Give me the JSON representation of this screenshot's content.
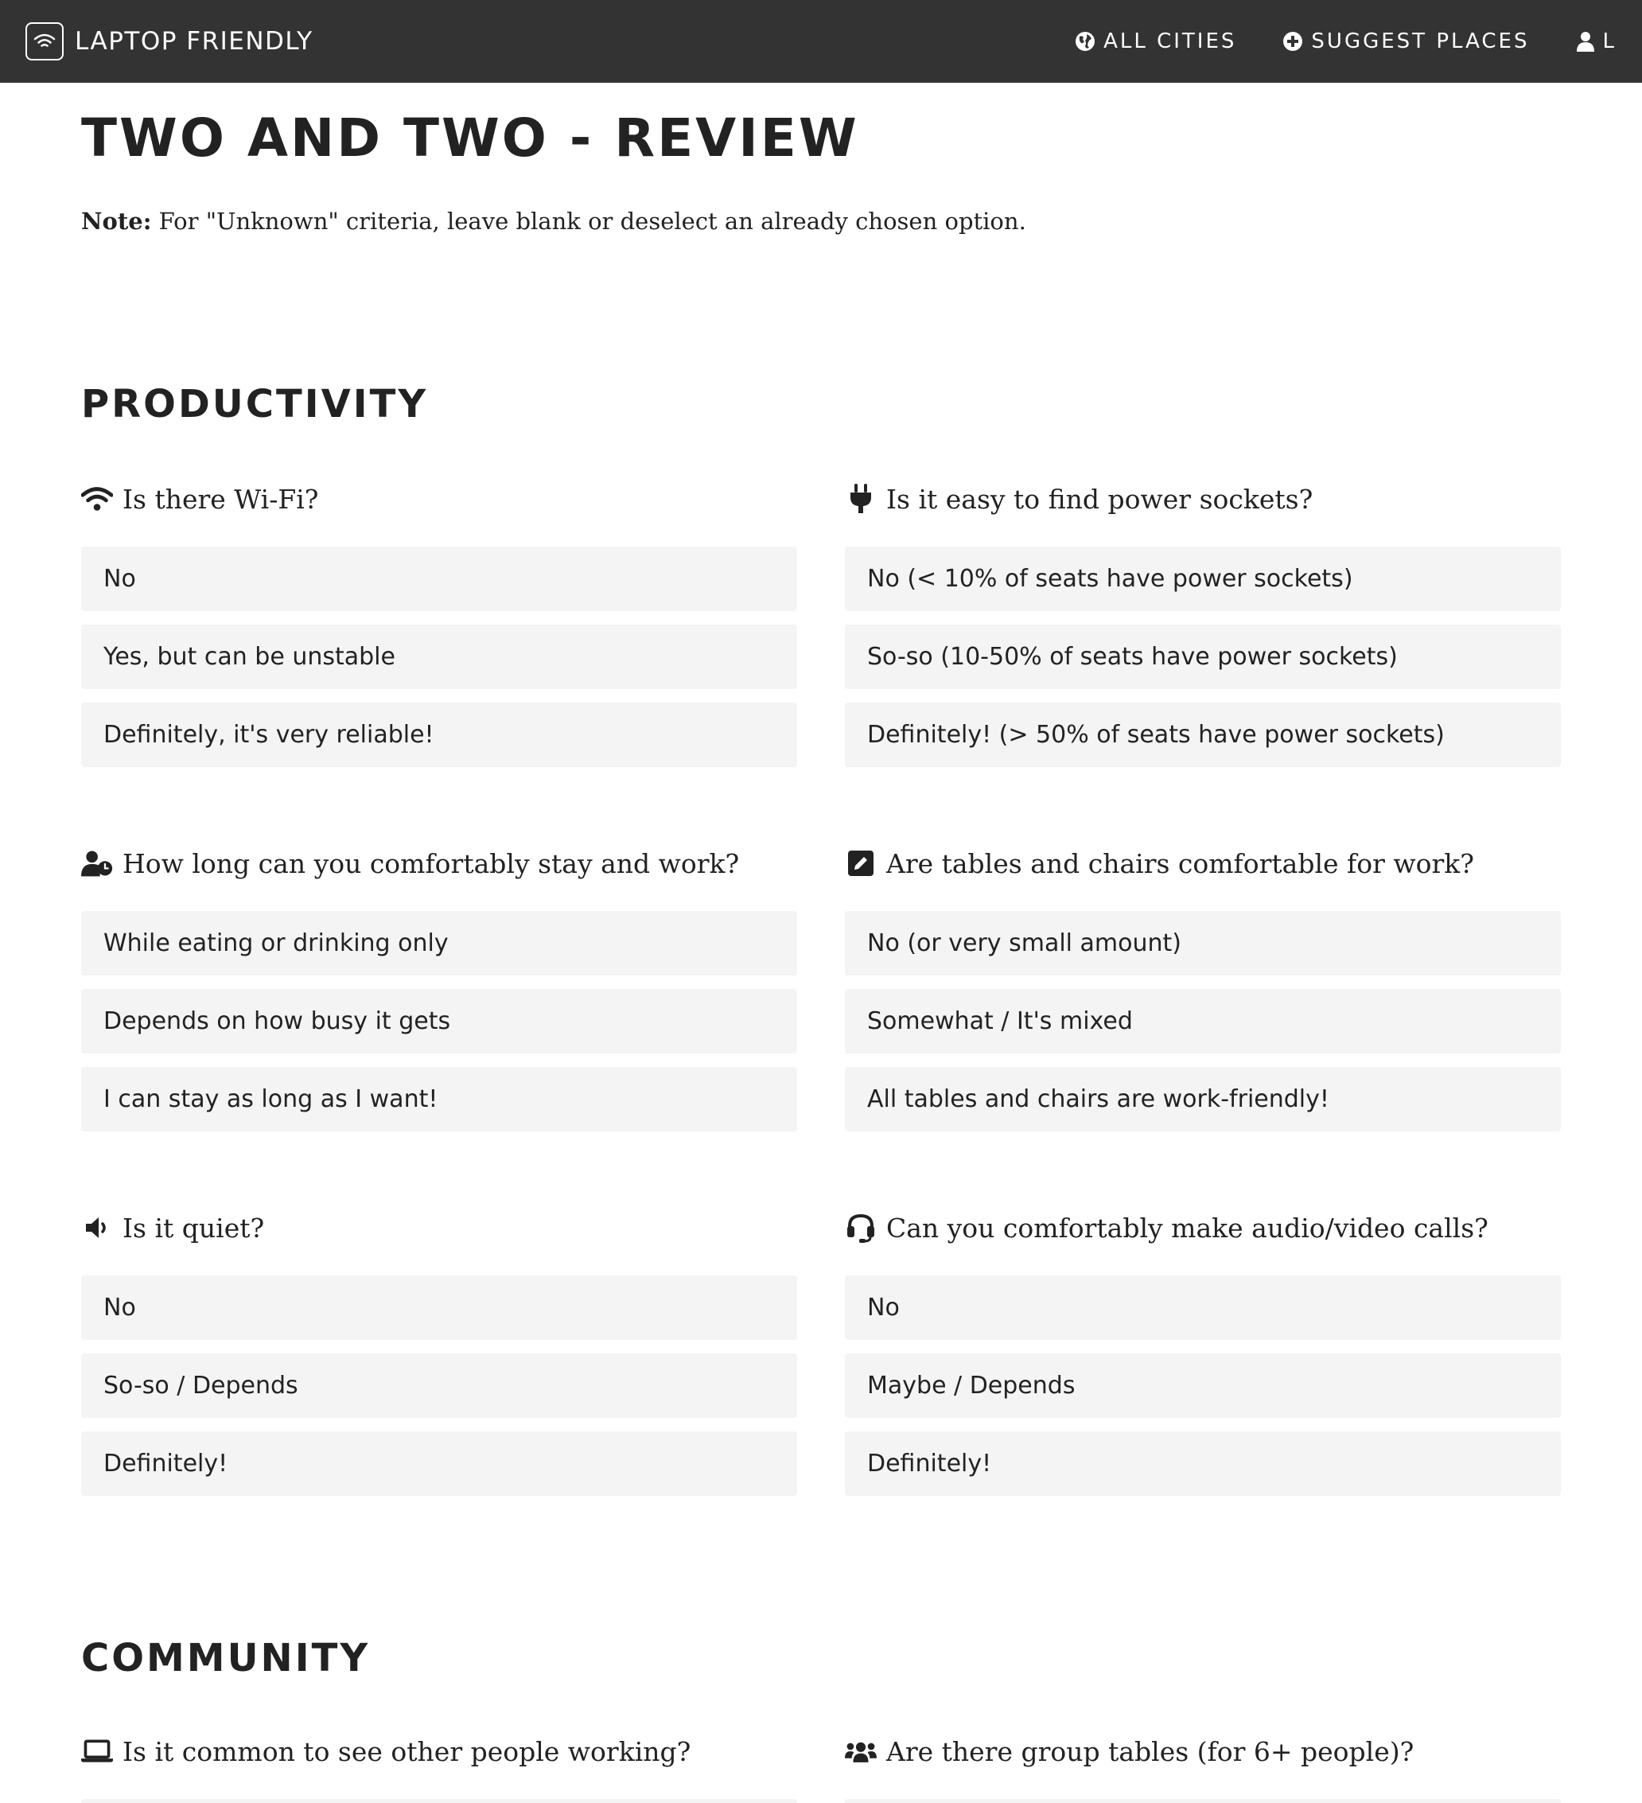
{
  "nav": {
    "brand": "LAPTOP FRIENDLY",
    "all_cities": "ALL CITIES",
    "suggest_places": "SUGGEST PLACES",
    "user": "L"
  },
  "page": {
    "title": "TWO AND TWO - REVIEW",
    "note_label": "Note:",
    "note_text": " For \"Unknown\" criteria, leave blank or deselect an already chosen option."
  },
  "sections": {
    "productivity": "PRODUCTIVITY",
    "community": "COMMUNITY"
  },
  "questions": {
    "wifi": {
      "icon": "wifi-icon",
      "label": "Is there Wi-Fi?",
      "options": [
        "No",
        "Yes, but can be unstable",
        "Definitely, it's very reliable!"
      ]
    },
    "power": {
      "icon": "plug-icon",
      "label": "Is it easy to find power sockets?",
      "options": [
        "No (< 10% of seats have power sockets)",
        "So-so (10-50% of seats have power sockets)",
        "Definitely! (> 50% of seats have power sockets)"
      ]
    },
    "stay": {
      "icon": "user-clock-icon",
      "label": "How long can you comfortably stay and work?",
      "options": [
        "While eating or drinking only",
        "Depends on how busy it gets",
        "I can stay as long as I want!"
      ]
    },
    "tables": {
      "icon": "edit-icon",
      "label": "Are tables and chairs comfortable for work?",
      "options": [
        "No (or very small amount)",
        "Somewhat / It's mixed",
        "All tables and chairs are work-friendly!"
      ]
    },
    "quiet": {
      "icon": "volume-icon",
      "label": "Is it quiet?",
      "options": [
        "No",
        "So-so / Depends",
        "Definitely!"
      ]
    },
    "calls": {
      "icon": "headset-icon",
      "label": "Can you comfortably make audio/video calls?",
      "options": [
        "No",
        "Maybe / Depends",
        "Definitely!"
      ]
    },
    "others_working": {
      "icon": "laptop-icon",
      "label": "Is it common to see other people working?"
    },
    "group_tables": {
      "icon": "users-icon",
      "label": "Are there group tables (for 6+ people)?"
    }
  }
}
